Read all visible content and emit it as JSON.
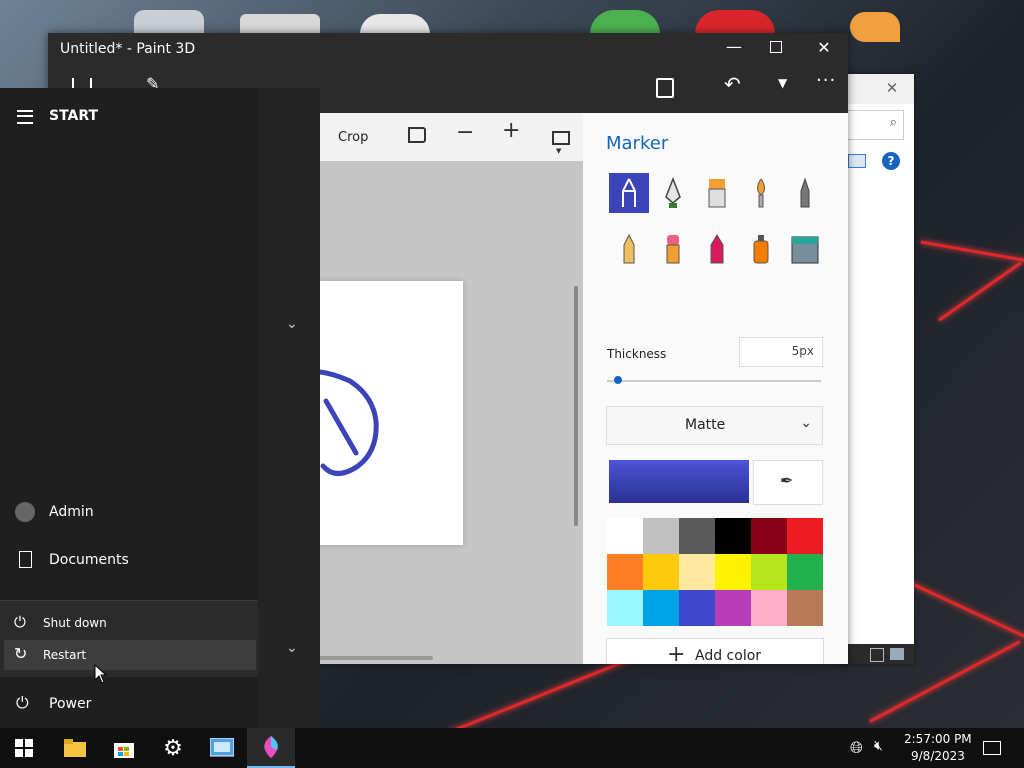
{
  "window": {
    "title": "Untitled* - Paint 3D"
  },
  "toolbar": {
    "crop_label": "Crop"
  },
  "panel": {
    "heading": "Marker",
    "thickness_label": "Thickness",
    "thickness_value": "5px",
    "thickness_level": 0.02,
    "finish_value": "Matte",
    "add_color_label": "Add color",
    "current_color": "#3b44b8",
    "palette": [
      "#ffffff",
      "#c0c0c0",
      "#595959",
      "#000000",
      "#880015",
      "#ed1c24",
      "#ff7f27",
      "#ffc90e",
      "#ffe8a0",
      "#fff200",
      "#b5e61d",
      "#22b14c",
      "#99f5ff",
      "#00a2e8",
      "#3f48cc",
      "#b83dba",
      "#ffaec9",
      "#b97a57"
    ],
    "tools": [
      "marker-icon",
      "calligraphy-pen-icon",
      "oil-brush-icon",
      "watercolor-icon",
      "pixel-pen-icon",
      "pencil-icon",
      "eraser-icon",
      "crayon-icon",
      "spray-can-icon",
      "fill-bucket-icon"
    ]
  },
  "start_menu": {
    "title": "START",
    "user": "Admin",
    "documents": "Documents",
    "shut_down": "Shut down",
    "restart": "Restart",
    "power": "Power"
  },
  "taskbar": {
    "time": "2:57:00 PM",
    "date": "9/8/2023",
    "apps": [
      "windows-logo-icon",
      "file-explorer-icon",
      "store-icon",
      "settings-icon",
      "control-panel-icon",
      "paint-3d-icon"
    ]
  }
}
